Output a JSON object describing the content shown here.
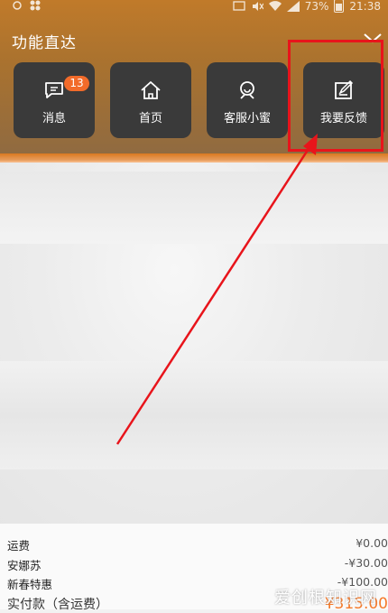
{
  "status_bar": {
    "battery": "73%",
    "time": "21:38"
  },
  "panel": {
    "title": "功能直达",
    "tiles": [
      {
        "label": "消息",
        "badge": "13",
        "icon": "message-icon"
      },
      {
        "label": "首页",
        "icon": "home-icon"
      },
      {
        "label": "客服小蜜",
        "icon": "customer-service-icon"
      },
      {
        "label": "我要反馈",
        "icon": "feedback-icon"
      }
    ]
  },
  "summary": {
    "rows": [
      {
        "label": "运费",
        "value": "¥0.00"
      },
      {
        "label": "安娜苏",
        "value": "-¥30.00"
      },
      {
        "label": "新春特惠",
        "value": "-¥100.00"
      },
      {
        "label": "实付款（含运费）",
        "value": "¥315.00"
      }
    ]
  },
  "watermark": "爱创根知识网",
  "colors": {
    "highlight": "#e8141b",
    "badge": "#f26b2a",
    "tile": "#3a3a3a",
    "total_price": "#f57a2a"
  }
}
